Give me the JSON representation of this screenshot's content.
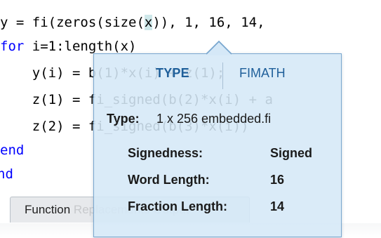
{
  "editor": {
    "lines": [
      {
        "pre": "y = fi(zeros(size(",
        "hl": "x",
        "post": ")), 1, 16, 14,"
      },
      {
        "kw": "for",
        "rest": " i=1:length(x)"
      },
      {
        "text": "    y(i) = b(1)*x(i) + z(1);"
      },
      {
        "text": "    z(1) = fi_signed(b(2)*x(i) + a"
      },
      {
        "text": "    z(2) = fi_signed(b(3)*x(i))"
      },
      {
        "kw": "end"
      },
      {
        "kw": "nd"
      }
    ]
  },
  "bottom_tab": {
    "label": "Function",
    "faded": " Replacements Output"
  },
  "popup": {
    "tabs": {
      "type": "TYPE",
      "fimath": "FIMATH"
    },
    "type_label": "Type:",
    "type_value": "1 x 256 embedded.fi",
    "properties": [
      {
        "label": "Signedness:",
        "value": "Signed"
      },
      {
        "label": "Word Length:",
        "value": "16"
      },
      {
        "label": "Fraction Length:",
        "value": "14"
      }
    ]
  },
  "colors": {
    "keyword": "#0000ff",
    "popup_bg": "#d5e8f7",
    "popup_border": "#79a7cf",
    "popup_tab_text": "#1f5f9a",
    "highlight": "#cfe8ea"
  }
}
